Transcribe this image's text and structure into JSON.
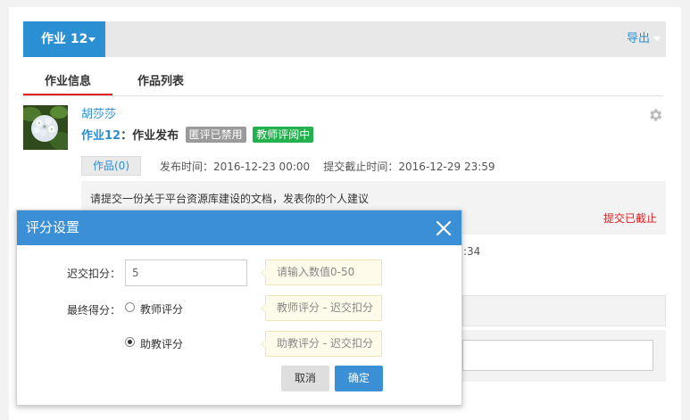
{
  "header": {
    "homework_dropdown": "作业 12",
    "export_label": "导出"
  },
  "tabs": [
    {
      "label": "作业信息",
      "active": true
    },
    {
      "label": "作品列表",
      "active": false
    }
  ],
  "post": {
    "author": "胡莎莎",
    "title_name": "作业12",
    "title_suffix": "：作业发布",
    "badge_peer": "匿评已禁用",
    "badge_teacher": "教师评阅中",
    "works_button": "作品(0)",
    "publish_time": "发布时间：2016-12-23 00:00",
    "deadline_time": "提交截止时间：2016-12-29 23:59",
    "description": "请提交一份关于平台资源库建设的文档，发表你的个人建议",
    "deadline_status": "提交已截止",
    "partial_time": ":34"
  },
  "modal": {
    "title": "评分设置",
    "late_deduct_label": "迟交扣分：",
    "late_deduct_value": "5",
    "late_deduct_hint": "请输入数值0-50",
    "final_score_label": "最终得分：",
    "options": [
      {
        "label": "教师评分",
        "hint": "教师评分 - 迟交扣分",
        "checked": false
      },
      {
        "label": "助教评分",
        "hint": "助教评分 - 迟交扣分",
        "checked": true
      }
    ],
    "cancel_label": "取消",
    "ok_label": "确定"
  },
  "colors": {
    "accent": "#2b8fd3",
    "modal_header": "#3b8fd4",
    "badge_gray": "#9a9a9a",
    "badge_green": "#22b14c",
    "deadline_red": "#e02020"
  }
}
